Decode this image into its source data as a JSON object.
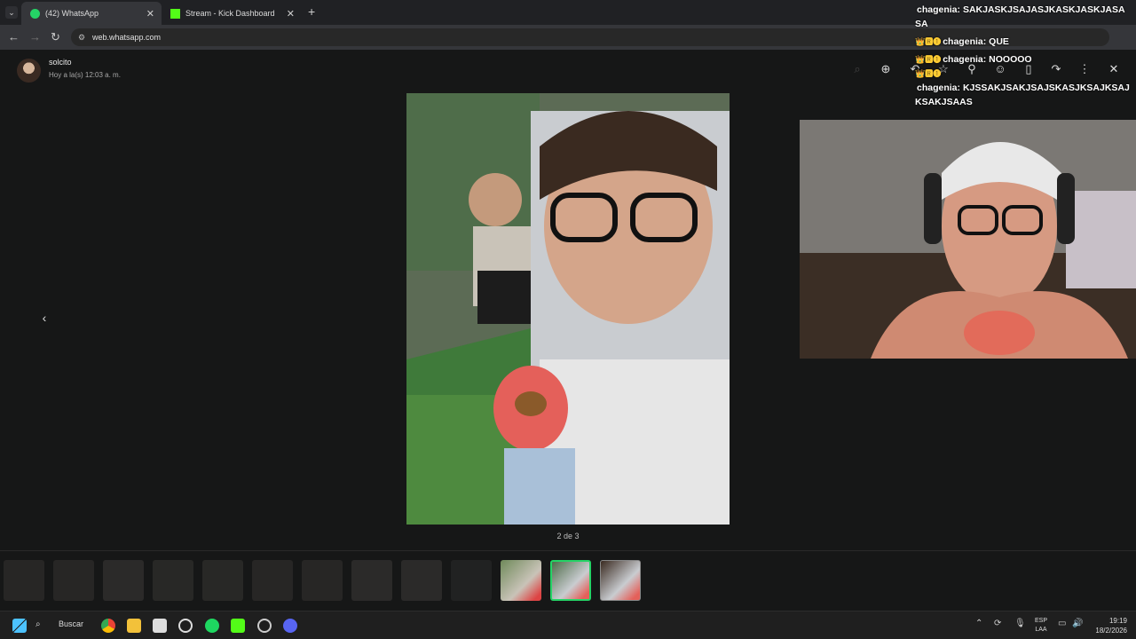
{
  "browser": {
    "tabs": [
      {
        "label": "(42) WhatsApp",
        "active": true
      },
      {
        "label": "Stream - Kick Dashboard",
        "active": false
      }
    ],
    "new_tab": "+",
    "url": "web.whatsapp.com"
  },
  "viewer": {
    "contact_name": "solcito",
    "timestamp": "Hoy a la(s) 12:03 a. m.",
    "counter": "2 de 3",
    "prev_arrow": "‹",
    "toolbar_icons": [
      "zoom-in-icon",
      "reply-icon",
      "star-icon",
      "pin-icon",
      "react-icon",
      "delete-icon",
      "forward-icon",
      "more-icon",
      "close-icon"
    ]
  },
  "chat": [
    {
      "badges": "",
      "user": "chagenia:",
      "text": "SAKJASKJSAJASJKASKJASKJASA SA"
    },
    {
      "badges": "👑🆁❶",
      "user": "chagenia:",
      "text": "QUE"
    },
    {
      "badges": "👑🆁❶",
      "user": "chagenia:",
      "text": "NOOOOO"
    },
    {
      "badges": "👑🆁❶",
      "user": "",
      "text": ""
    },
    {
      "badges": "",
      "user": "chagenia:",
      "text": "KJSSAKJSAKJSAJSKASJKSAJKSAJ KSAKJSAAS"
    }
  ],
  "taskbar": {
    "search_label": "Buscar",
    "lang_top": "ESP",
    "lang_bottom": "LAA",
    "time": "19:19",
    "date": "18/2/2026"
  },
  "colors": {
    "accent_green": "#25d366",
    "background": "#161717"
  }
}
